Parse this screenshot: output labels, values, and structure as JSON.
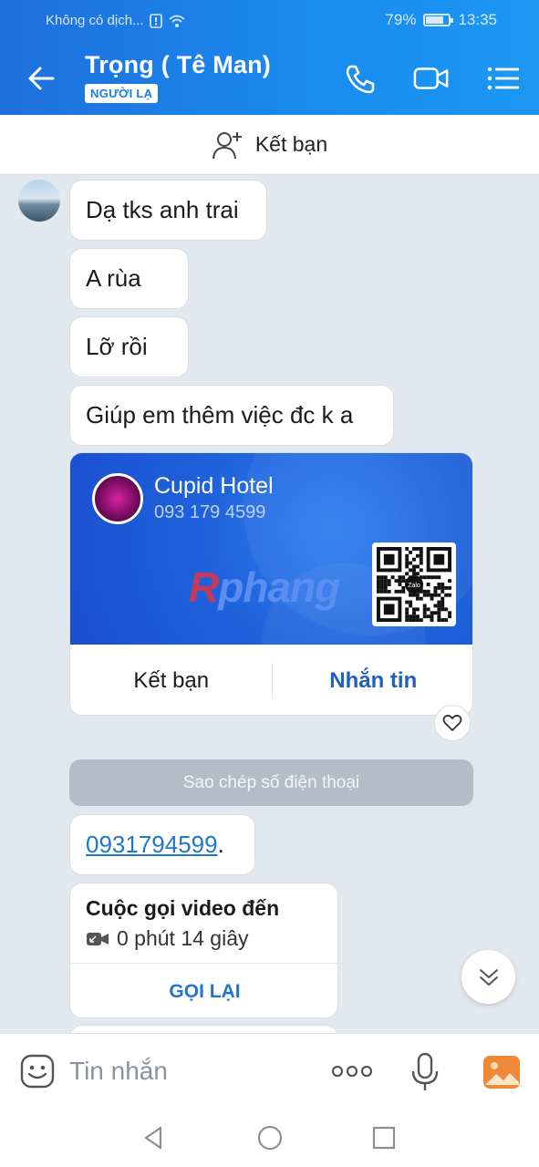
{
  "status_bar": {
    "carrier": "Không có dịch...",
    "battery_percent": "79%",
    "battery_level": 0.79,
    "time": "13:35"
  },
  "header": {
    "title": "Trọng ( Tê Man)",
    "badge": "NGƯỜI LẠ",
    "icons": [
      "back-arrow-icon",
      "phone-icon",
      "video-call-icon",
      "menu-list-icon"
    ]
  },
  "add_friend_bar": {
    "label": "Kết bạn"
  },
  "messages": [
    {
      "text": "Dạ tks anh trai"
    },
    {
      "text": "A rùa"
    },
    {
      "text": "Lỡ rồi"
    },
    {
      "text": "Giúp em thêm việc đc k a"
    }
  ],
  "contact_card": {
    "name": "Cupid Hotel",
    "phone": "093 179 4599",
    "watermark": "Rphang",
    "watermark_first": "R",
    "watermark_rest": "phang",
    "qr_logo": "Zalo",
    "add_friend_label": "Kết bạn",
    "message_label": "Nhắn tin"
  },
  "copy_phone_label": "Sao chép số điện thoại",
  "phone_message": {
    "number": "0931794599",
    "suffix": "."
  },
  "video_call": {
    "title": "Cuộc gọi video đến",
    "duration": "0 phút 14 giây",
    "call_back_label": "GỌI LẠI"
  },
  "input_bar": {
    "placeholder": "Tin nhắn"
  },
  "colors": {
    "header": "#1a8cf0",
    "card": "#1f62dc",
    "link": "#1f76d2",
    "chat_bg": "#e2e8ef"
  }
}
